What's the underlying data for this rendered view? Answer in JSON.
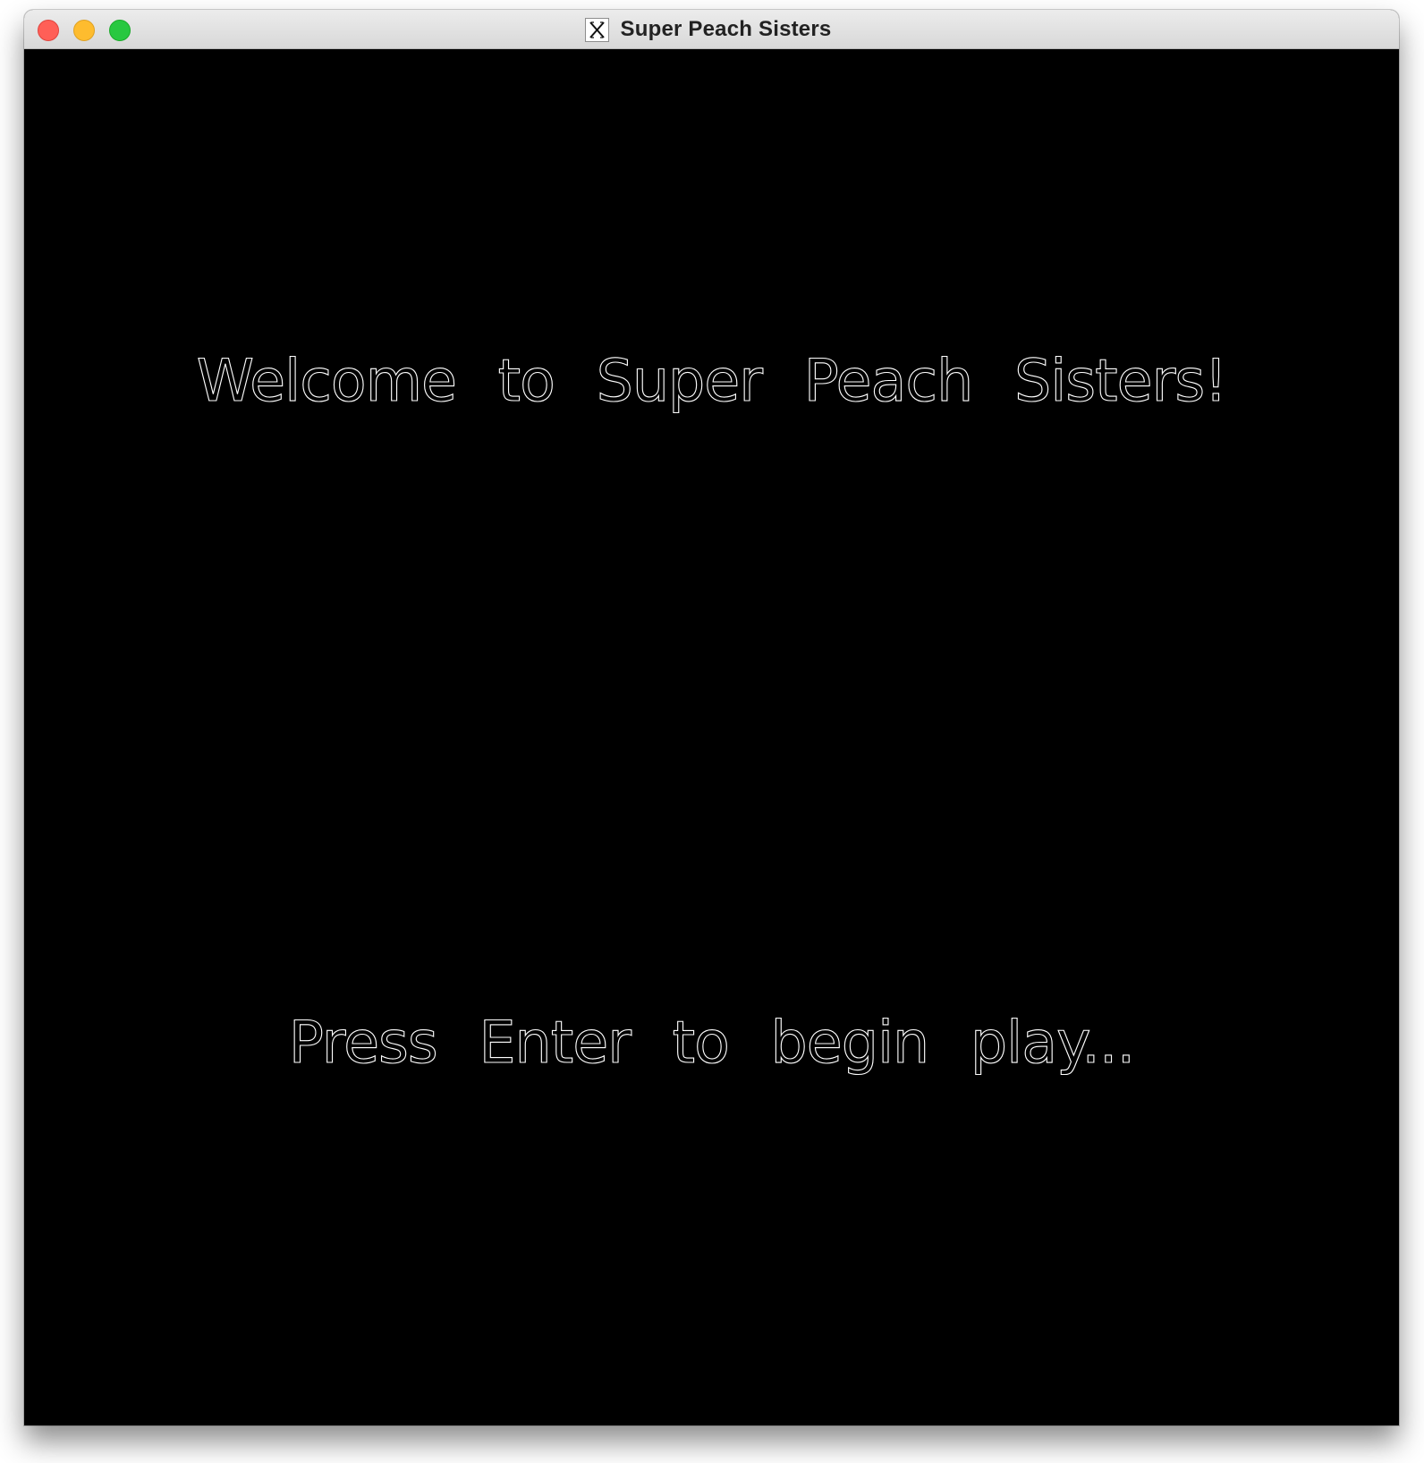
{
  "window": {
    "title": "Super Peach Sisters",
    "controls": [
      {
        "name": "close",
        "color": "#ff5f57"
      },
      {
        "name": "minimize",
        "color": "#febc2e"
      },
      {
        "name": "maximize",
        "color": "#28c840"
      }
    ],
    "app_icon": "x11-icon"
  },
  "game": {
    "background_color": "#000000",
    "text_color": "#ffffff",
    "welcome_text": "Welcome to Super Peach Sisters!",
    "prompt_text": "Press Enter to begin play..."
  }
}
